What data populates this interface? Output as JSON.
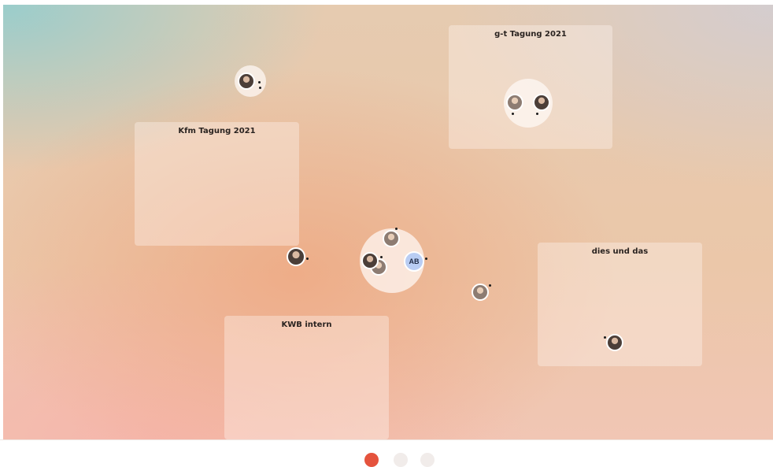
{
  "rooms": [
    {
      "title": "g-t Tagung 2021"
    },
    {
      "title": "Kfm Tagung 2021"
    },
    {
      "title": "dies und das"
    },
    {
      "title": "KWB intern"
    }
  ],
  "participants": {
    "self_initials": "AB"
  },
  "colors": {
    "accent_red": "#e5533d",
    "initials_bg": "#b9cdf3"
  }
}
